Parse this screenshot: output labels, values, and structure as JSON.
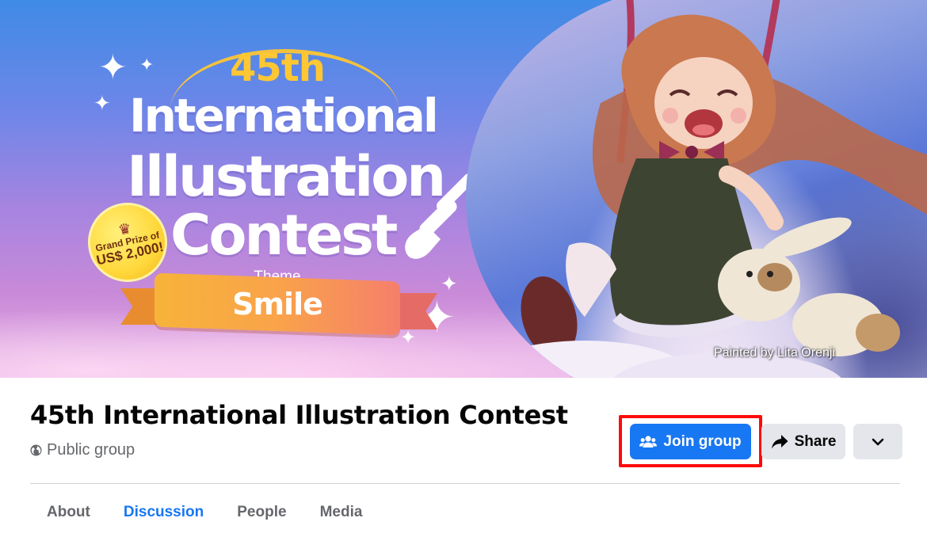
{
  "cover": {
    "headline_number": "45th",
    "headline_line1": "International",
    "headline_line2": "Illustration",
    "headline_line3": "Contest",
    "badge_line1": "Grand Prize of",
    "badge_line2": "US$ 2,000!",
    "theme_label": "Theme",
    "theme_value": "Smile",
    "credit": "Painted by Lita Orenji"
  },
  "group": {
    "title": "45th International Illustration Contest",
    "privacy": "Public group"
  },
  "actions": {
    "join_label": "Join group",
    "share_label": "Share"
  },
  "tabs": [
    {
      "label": "About"
    },
    {
      "label": "Discussion"
    },
    {
      "label": "People"
    },
    {
      "label": "Media"
    }
  ],
  "active_tab": "Discussion",
  "colors": {
    "primary": "#1877f2",
    "secondary_button": "#e4e6eb",
    "highlight_box": "#ff0a0a",
    "muted_text": "#65676b"
  },
  "icons": {
    "privacy": "globe-icon",
    "join": "group-icon",
    "share": "share-arrow-icon",
    "more": "chevron-down-icon"
  }
}
